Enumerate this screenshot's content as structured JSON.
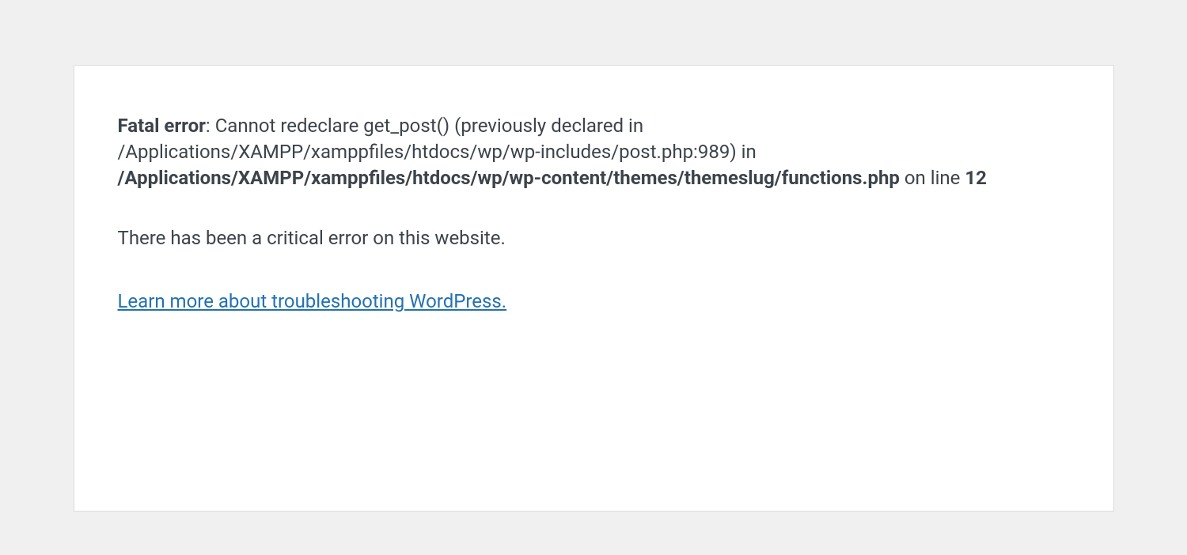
{
  "error": {
    "label": "Fatal error",
    "separator": ": ",
    "message_part1": "Cannot redeclare get_post() (previously declared in /Applications/XAMPP/xamppfiles/htdocs/wp/wp-includes/post.php:989) in ",
    "file_path": "/Applications/XAMPP/xamppfiles/htdocs/wp/wp-content/themes/themeslug/functions.php",
    "on_line_text": " on line ",
    "line_number": "12"
  },
  "critical_error_text": "There has been a critical error on this website.",
  "troubleshoot_link_text": "Learn more about troubleshooting WordPress."
}
